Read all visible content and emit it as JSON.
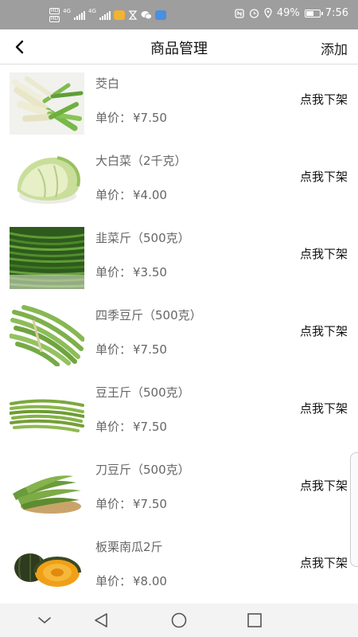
{
  "status": {
    "sim1": "HD",
    "sim2": "HD",
    "net1": "4G",
    "net2": "4G",
    "battery_text": "49%",
    "battery_level": 0.49,
    "time": "7:56"
  },
  "header": {
    "title": "商品管理",
    "add_label": "添加"
  },
  "products": [
    {
      "name": "茭白",
      "price_label": "单价：",
      "price": "¥7.50",
      "action": "点我下架",
      "image": "water-bamboo-image"
    },
    {
      "name": "大白菜（2千克）",
      "price_label": "单价：",
      "price": "¥4.00",
      "action": "点我下架",
      "image": "chinese-cabbage-image"
    },
    {
      "name": "韭菜斤（500克）",
      "price_label": "单价：",
      "price": "¥3.50",
      "action": "点我下架",
      "image": "chives-image"
    },
    {
      "name": "四季豆斤（500克）",
      "price_label": "单价：",
      "price": "¥7.50",
      "action": "点我下架",
      "image": "green-beans-image"
    },
    {
      "name": "豆王斤（500克）",
      "price_label": "单价：",
      "price": "¥7.50",
      "action": "点我下架",
      "image": "long-beans-image"
    },
    {
      "name": "刀豆斤（500克）",
      "price_label": "单价：",
      "price": "¥7.50",
      "action": "点我下架",
      "image": "sword-beans-image"
    },
    {
      "name": "板栗南瓜2斤",
      "price_label": "单价：",
      "price": "¥8.00",
      "action": "点我下架",
      "image": "chestnut-pumpkin-image"
    }
  ],
  "colors": {
    "status_bar": "#9e9e9e",
    "text_secondary": "#666666",
    "nav_bar": "#f3f3f3"
  },
  "nav": {
    "icons": [
      "chevron-down-icon",
      "back-triangle-icon",
      "home-circle-icon",
      "recents-square-icon"
    ]
  }
}
